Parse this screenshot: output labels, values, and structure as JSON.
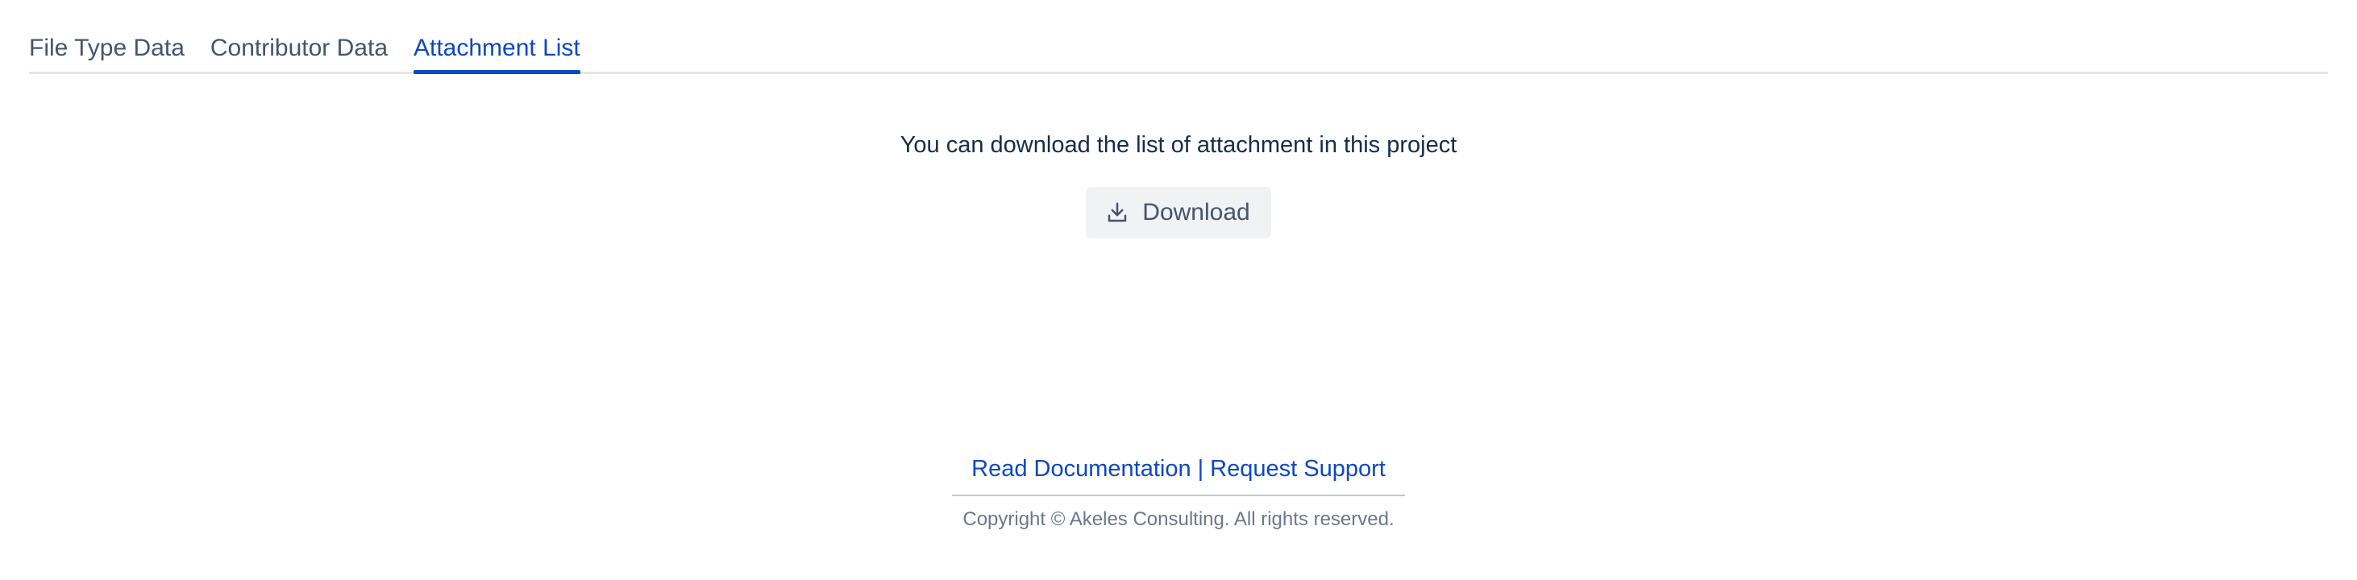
{
  "tabs": [
    {
      "label": "File Type Data",
      "active": false
    },
    {
      "label": "Contributor Data",
      "active": false
    },
    {
      "label": "Attachment List",
      "active": true
    }
  ],
  "main": {
    "message": "You can download the list of attachment in this project",
    "download_label": "Download",
    "download_icon": "download-icon"
  },
  "footer": {
    "documentation_link": "Read Documentation",
    "separator": "|",
    "support_link": "Request Support",
    "copyright": "Copyright © Akeles Consulting. All rights reserved."
  },
  "colors": {
    "accent": "#0c48c0",
    "tab_text": "#44546f",
    "button_bg": "#f1f2f4",
    "muted_text": "#6b778c"
  }
}
